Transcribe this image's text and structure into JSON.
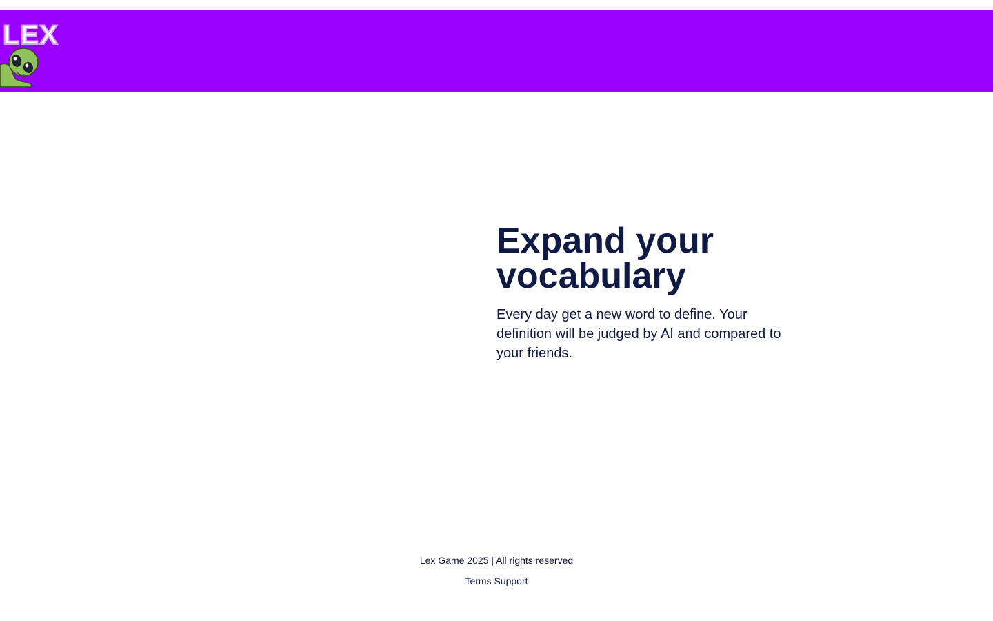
{
  "header": {
    "background": "#9900ff",
    "logo_text": "LEX",
    "mascot": "green-alien-icon"
  },
  "hero": {
    "title": "Expand your vocabulary",
    "subtitle": "Every day get a new word to define. Your definition will be judged by AI and compared to your friends."
  },
  "footer": {
    "copyright": "Lex Game 2025 | All rights reserved",
    "links": [
      {
        "label": "Terms"
      },
      {
        "label": "Support"
      }
    ]
  },
  "colors": {
    "text": "#0f1a45",
    "accent": "#9900ff",
    "mascot_green": "#8fc25a"
  }
}
